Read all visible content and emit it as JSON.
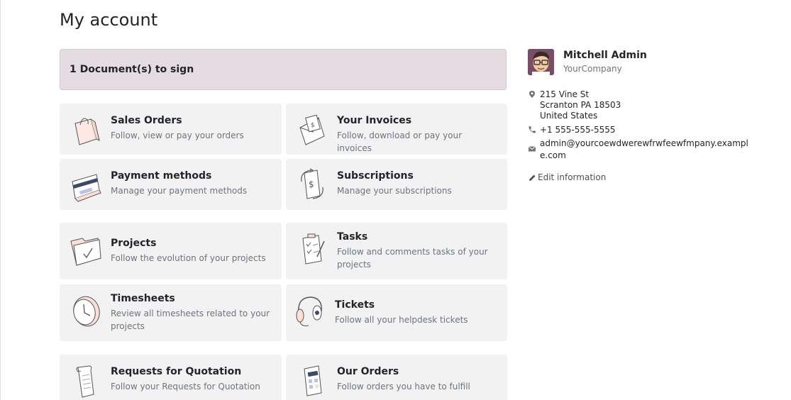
{
  "page": {
    "title": "My account"
  },
  "sign_banner": {
    "label": "1 Document(s) to sign"
  },
  "cards": {
    "sales_orders": {
      "title": "Sales Orders",
      "subtitle": "Follow, view or pay your orders",
      "icon": "shopping-bag-icon"
    },
    "invoices": {
      "title": "Your Invoices",
      "subtitle": "Follow, download or pay your invoices",
      "icon": "invoice-envelope-icon"
    },
    "payment_methods": {
      "title": "Payment methods",
      "subtitle": "Manage your payment methods",
      "icon": "credit-card-icon"
    },
    "subscriptions": {
      "title": "Subscriptions",
      "subtitle": "Manage your subscriptions",
      "icon": "recurring-payment-icon"
    },
    "projects": {
      "title": "Projects",
      "subtitle": "Follow the evolution of your projects",
      "icon": "folder-check-icon"
    },
    "tasks": {
      "title": "Tasks",
      "subtitle": "Follow and comments tasks of your projects",
      "icon": "clipboard-checklist-icon"
    },
    "timesheets": {
      "title": "Timesheets",
      "subtitle": "Review all timesheets related to your projects",
      "icon": "clock-icon"
    },
    "tickets": {
      "title": "Tickets",
      "subtitle": "Follow all your helpdesk tickets",
      "icon": "headset-icon"
    },
    "rfq": {
      "title": "Requests for Quotation",
      "subtitle": "Follow your Requests for Quotation",
      "icon": "scroll-document-icon"
    },
    "our_orders": {
      "title": "Our Orders",
      "subtitle": "Follow orders you have to fulfill",
      "icon": "order-form-icon"
    }
  },
  "profile": {
    "name": "Mitchell Admin",
    "company": "YourCompany",
    "address_line1": "215 Vine St",
    "address_line2": "Scranton PA 18503",
    "address_line3": "United States",
    "phone": "+1 555-555-5555",
    "email": "admin@yourcoewdwerewfrwfeewfmpany.example.com",
    "edit_label": "Edit information"
  },
  "colors": {
    "banner_bg": "#e5dce2",
    "card_bg": "#f2f2f2",
    "text": "#212529",
    "muted": "#6c757d"
  }
}
